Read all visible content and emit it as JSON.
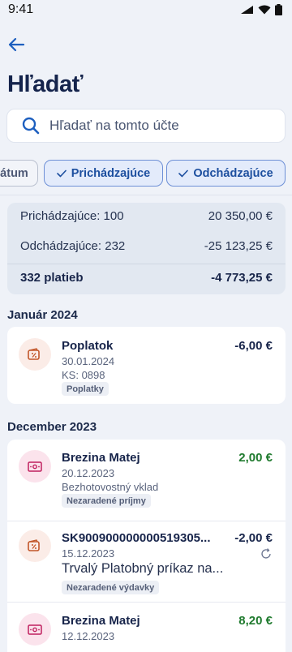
{
  "status_bar": {
    "time": "9:41"
  },
  "header": {
    "title": "Hľadať"
  },
  "search": {
    "placeholder": "Hľadať na tomto účte"
  },
  "filters": {
    "partial_chip": "átum",
    "incoming": "Prichádzajúce",
    "outgoing": "Odchádzajúce"
  },
  "summary": {
    "incoming_label": "Prichádzajúce: 100",
    "incoming_value": "20 350,00 €",
    "outgoing_label": "Odchádzajúce: 232",
    "outgoing_value": "-25 123,25 €",
    "total_label": "332 platieb",
    "total_value": "-4 773,25 €"
  },
  "sections": [
    {
      "title": "Január 2024",
      "transactions": [
        {
          "icon": "fee-percent-icon",
          "name": "Poplatok",
          "amount": "-6,00 €",
          "date": "30.01.2024",
          "detail": "KS: 0898",
          "tag": "Poplatky"
        }
      ]
    },
    {
      "title": "December 2023",
      "transactions": [
        {
          "icon": "cash-icon",
          "name": "Brezina Matej",
          "amount": "2,00 €",
          "date": "20.12.2023",
          "detail": "Bezhotovostný vklad",
          "tag": "Nezaradené príjmy"
        },
        {
          "icon": "fee-percent-icon",
          "name": "SK900900000000519305...",
          "amount": "-2,00 €",
          "date": "15.12.2023",
          "detail": "Trvalý Platobný príkaz na...",
          "tag": "Nezaradené výdavky"
        },
        {
          "icon": "cash-icon",
          "name": "Brezina Matej",
          "amount": "8,20 €",
          "date": "12.12.2023"
        }
      ]
    }
  ],
  "colors": {
    "accent": "#1d4f9f",
    "positive": "#1f7a2e",
    "background": "#eff2f8"
  }
}
